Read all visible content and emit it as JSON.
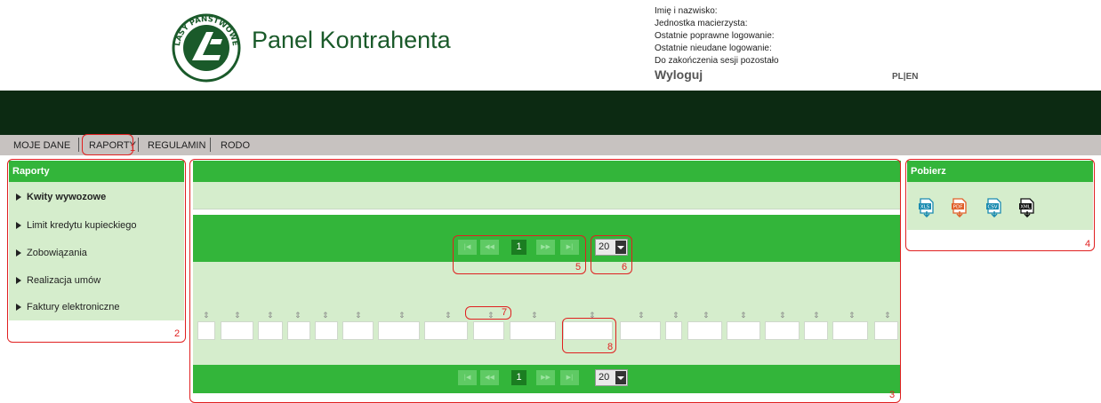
{
  "header": {
    "brand": "Panel Kontrahenta",
    "logo_text": "LASY PAŃSTWOWE",
    "user_info": [
      "Imię i nazwisko:",
      "Jednostka macierzysta:",
      "Ostatnie poprawne logowanie:",
      "Ostatnie nieudane logowanie:",
      "Do zakończenia sesji pozostało"
    ],
    "logout": "Wyloguj",
    "lang_pl": "PL",
    "lang_sep": "|",
    "lang_en": "EN"
  },
  "menu": {
    "items": [
      "MOJE DANE",
      "RAPORTY",
      "REGULAMIN",
      "RODO"
    ]
  },
  "sidebar": {
    "title": "Raporty",
    "items": [
      "Kwity wywozowe",
      "Limit kredytu kupieckiego",
      "Zobowiązania",
      "Realizacja umów",
      "Faktury elektroniczne"
    ]
  },
  "pagination": {
    "current_page": "1",
    "per_page": "20"
  },
  "download": {
    "title": "Pobierz",
    "formats": [
      "XLS",
      "PDF",
      "CSV",
      "XML"
    ]
  },
  "annotations": [
    "1",
    "2",
    "3",
    "4",
    "5",
    "6",
    "7",
    "8"
  ],
  "colors": {
    "green": "#33b53a",
    "light_green": "#d5edcc",
    "dark_bar": "#0c2a12",
    "annotation_red": "#e02020"
  }
}
